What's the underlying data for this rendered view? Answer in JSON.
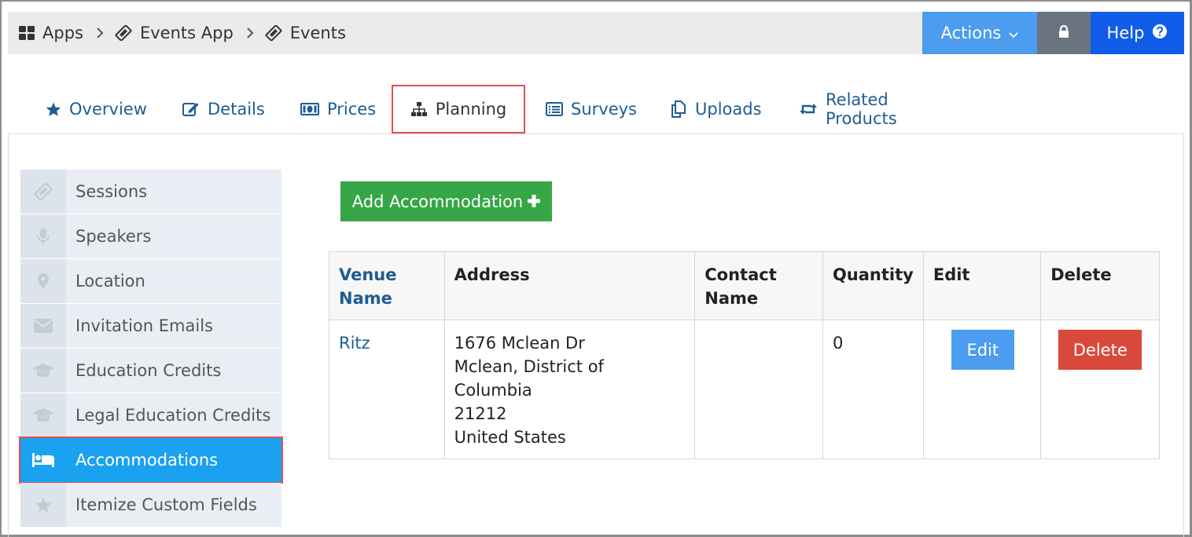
{
  "breadcrumb": {
    "items": [
      {
        "label": "Apps",
        "icon": "grid-icon"
      },
      {
        "label": "Events App",
        "icon": "ticket-icon"
      },
      {
        "label": "Events",
        "icon": "ticket-icon"
      }
    ]
  },
  "header_actions": {
    "actions_label": "Actions",
    "lock_icon": "lock-icon",
    "help_label": "Help"
  },
  "tabs": [
    {
      "label": "Overview",
      "icon": "star-icon"
    },
    {
      "label": "Details",
      "icon": "edit-icon"
    },
    {
      "label": "Prices",
      "icon": "money-icon"
    },
    {
      "label": "Planning",
      "icon": "sitemap-icon",
      "active": true
    },
    {
      "label": "Surveys",
      "icon": "list-icon"
    },
    {
      "label": "Uploads",
      "icon": "copy-icon"
    },
    {
      "label": "Related Products",
      "icon": "retweet-icon"
    }
  ],
  "sidebar": {
    "items": [
      {
        "label": "Sessions",
        "icon": "ticket-icon"
      },
      {
        "label": "Speakers",
        "icon": "microphone-icon"
      },
      {
        "label": "Location",
        "icon": "map-marker-icon"
      },
      {
        "label": "Invitation Emails",
        "icon": "envelope-icon"
      },
      {
        "label": "Education Credits",
        "icon": "graduation-cap-icon"
      },
      {
        "label": "Legal Education Credits",
        "icon": "graduation-cap-icon"
      },
      {
        "label": "Accommodations",
        "icon": "bed-icon",
        "active": true
      },
      {
        "label": "Itemize Custom Fields",
        "icon": "star-icon"
      }
    ]
  },
  "main": {
    "add_button_label": "Add Accommodation",
    "table": {
      "headers": [
        "Venue Name",
        "Address",
        "Contact Name",
        "Quantity",
        "Edit",
        "Delete"
      ],
      "rows": [
        {
          "venue": "Ritz",
          "address_lines": [
            "1676 Mclean Dr",
            "Mclean, District of Columbia",
            "21212",
            "United States"
          ],
          "contact": "",
          "quantity": "0",
          "edit_label": "Edit",
          "delete_label": "Delete"
        }
      ]
    }
  },
  "colors": {
    "accent_blue": "#4c9cf0",
    "help_blue": "#0f5de8",
    "active_sidebar": "#1aa1f0",
    "add_green": "#36a646",
    "delete_red": "#d9493b",
    "highlight_outline": "#d9534f",
    "link": "#1e5c93"
  }
}
